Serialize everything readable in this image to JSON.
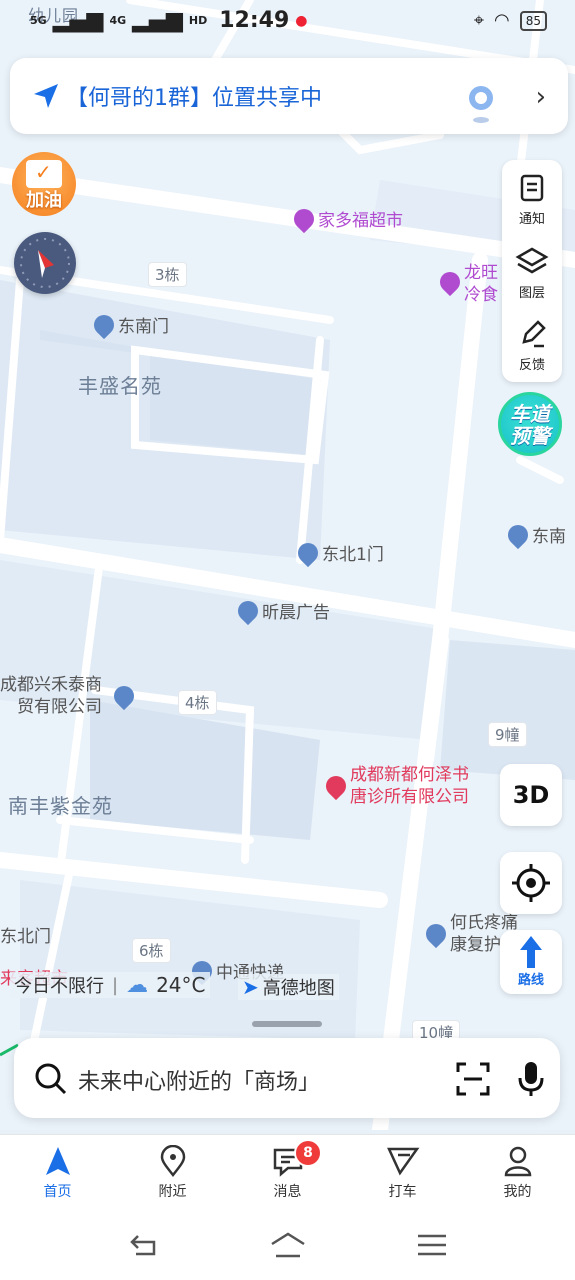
{
  "status_bar": {
    "signal_1": "5G",
    "signal_2": "4G",
    "hd": "HD",
    "time": "12:49",
    "battery": "85"
  },
  "share_bar": {
    "text": "【何哥的1群】位置共享中"
  },
  "left_buttons": {
    "fuel": "加油"
  },
  "right_panel": {
    "notify": "通知",
    "layers": "图层",
    "feedback": "反馈",
    "lane_warning_line1": "车道",
    "lane_warning_line2": "预警"
  },
  "map": {
    "pois": {
      "jiaduofu": "家多福超市",
      "longwang_1": "龙旺",
      "longwang_2": "冷食",
      "dongnanmen": "东南门",
      "dongbei1men": "东北1门",
      "xichen": "昕晨广告",
      "xinghetai_1": "成都兴禾泰商",
      "xinghetai_2": "贸有限公司",
      "hezeshu_1": "成都新都何泽书",
      "hezeshu_2": "唐诊所有限公司",
      "heshi_1": "何氏疼痛",
      "heshi_2": "康复护",
      "zhongtong": "中通快递",
      "dongnan_right": "东南",
      "dongbeimen": "东北门",
      "lai_chao": "来客超市"
    },
    "areas": {
      "fengsheng": "丰盛名苑",
      "nanfeng": "南丰紫金苑",
      "kindergarten": "幼儿园"
    },
    "buildings": {
      "b3": "3栋",
      "b4": "4栋",
      "b6": "6栋",
      "b9": "9幢",
      "b10": "10幢"
    }
  },
  "map_buttons": {
    "three_d": "3D",
    "route": "路线"
  },
  "overlay": {
    "restriction": "今日不限行",
    "temperature": "24°C",
    "logo": "高德地图"
  },
  "search": {
    "placeholder": "未来中心附近的「商场」"
  },
  "tabs": [
    {
      "label": "首页"
    },
    {
      "label": "附近"
    },
    {
      "label": "消息",
      "badge": "8"
    },
    {
      "label": "打车"
    },
    {
      "label": "我的"
    }
  ]
}
